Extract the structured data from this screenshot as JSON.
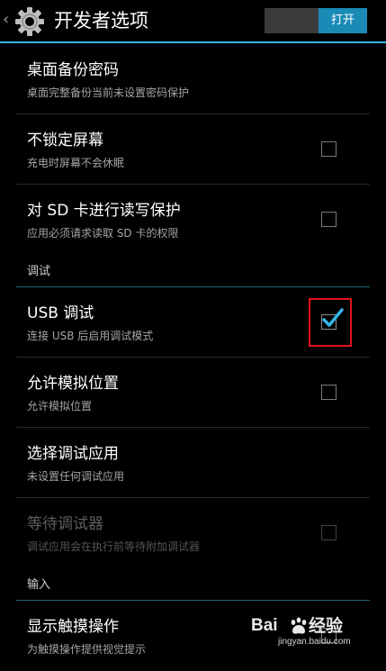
{
  "action_bar": {
    "back_glyph": "‹",
    "title": "开发者选项",
    "switch_label": "打开"
  },
  "rows_top": [
    {
      "title": "桌面备份密码",
      "summary": "桌面完整备份当前未设置密码保护",
      "has_checkbox": false,
      "checked": false,
      "enabled": true
    },
    {
      "title": "不锁定屏幕",
      "summary": "充电时屏幕不会休眠",
      "has_checkbox": true,
      "checked": false,
      "enabled": true
    },
    {
      "title": "对 SD 卡进行读写保护",
      "summary": "应用必须请求读取 SD 卡的权限",
      "has_checkbox": true,
      "checked": false,
      "enabled": true
    }
  ],
  "section_debug": "调试",
  "rows_debug": [
    {
      "title": "USB 调试",
      "summary": "连接 USB 后启用调试模式",
      "has_checkbox": true,
      "checked": true,
      "enabled": true
    },
    {
      "title": "允许模拟位置",
      "summary": "允许模拟位置",
      "has_checkbox": true,
      "checked": false,
      "enabled": true
    },
    {
      "title": "选择调试应用",
      "summary": "未设置任何调试应用",
      "has_checkbox": false,
      "checked": false,
      "enabled": true
    },
    {
      "title": "等待调试器",
      "summary": "调试应用会在执行前等待附加调试器",
      "has_checkbox": true,
      "checked": false,
      "enabled": false
    }
  ],
  "section_input": "输入",
  "rows_input": [
    {
      "title": "显示触摸操作",
      "summary": "为触摸操作提供视觉提示",
      "has_checkbox": true,
      "checked": false,
      "enabled": true
    }
  ],
  "watermark": {
    "left": "Bai",
    "right": "经验",
    "url": "jingyan.baidu.com"
  },
  "colors": {
    "accent": "#33b5e5",
    "switch_on": "#1a8bb7",
    "highlight": "#e0121b"
  }
}
